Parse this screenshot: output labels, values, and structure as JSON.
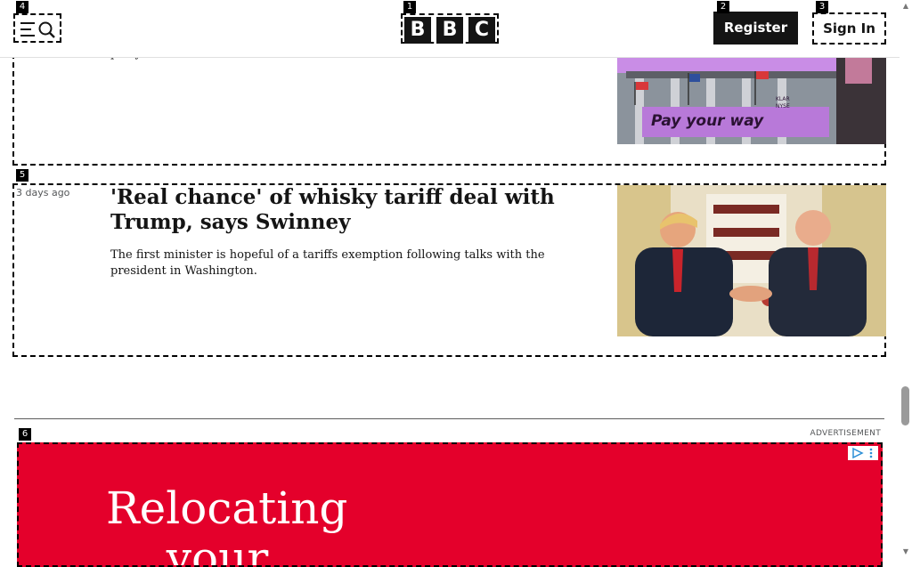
{
  "header": {
    "logo_letters": [
      "B",
      "B",
      "C"
    ],
    "register_label": "Register",
    "signin_label": "Sign In"
  },
  "markers": [
    "1",
    "2",
    "3",
    "4",
    "5",
    "6"
  ],
  "articles": [
    {
      "summary_fragment": "party"
    },
    {
      "timestamp": "3 days ago",
      "headline": "'Real chance' of whisky tariff deal with Trump, says Swinney",
      "summary": "The first minister is hopeful of a tariffs exemption following talks with the president in Washington."
    }
  ],
  "image1": {
    "banner_text": "Pay your way",
    "sign_text": "KLAR NYSE"
  },
  "ad": {
    "label": "ADVERTISEMENT",
    "headline_line1": "Relocating",
    "headline_line2": "your"
  },
  "colors": {
    "ad_background": "#e4002b",
    "banner_purple": "#b879d9",
    "header_black": "#141414"
  }
}
